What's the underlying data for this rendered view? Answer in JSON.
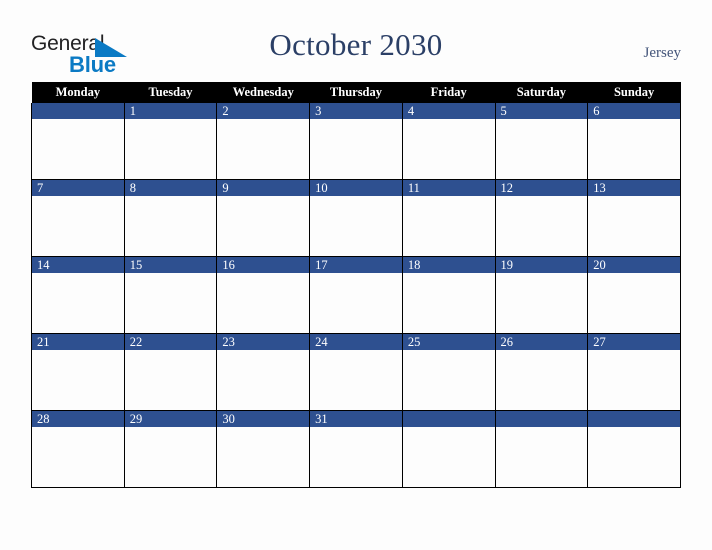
{
  "brand": {
    "name_part1": "General",
    "name_part2": "Blue",
    "triangle_icon": "triangle-right-icon",
    "triangle_color": "#0b7ac4",
    "text_color": "#222224"
  },
  "header": {
    "title": "October 2030",
    "month": "October",
    "year": "2030",
    "region": "Jersey",
    "title_color": "#2b3f66",
    "region_color": "#44557a"
  },
  "calendar": {
    "weekday_headers": [
      "Monday",
      "Tuesday",
      "Wednesday",
      "Thursday",
      "Friday",
      "Saturday",
      "Sunday"
    ],
    "header_background": "#000000",
    "header_text_color": "#ffffff",
    "day_band_color": "#2e5090",
    "day_number_color": "#ffffff",
    "cell_background": "#fdfdfd",
    "grid_line_color": "#000000",
    "weeks": [
      {
        "days": [
          "",
          "1",
          "2",
          "3",
          "4",
          "5",
          "6"
        ]
      },
      {
        "days": [
          "7",
          "8",
          "9",
          "10",
          "11",
          "12",
          "13"
        ]
      },
      {
        "days": [
          "14",
          "15",
          "16",
          "17",
          "18",
          "19",
          "20"
        ]
      },
      {
        "days": [
          "21",
          "22",
          "23",
          "24",
          "25",
          "26",
          "27"
        ]
      },
      {
        "days": [
          "28",
          "29",
          "30",
          "31",
          "",
          "",
          ""
        ]
      }
    ]
  }
}
